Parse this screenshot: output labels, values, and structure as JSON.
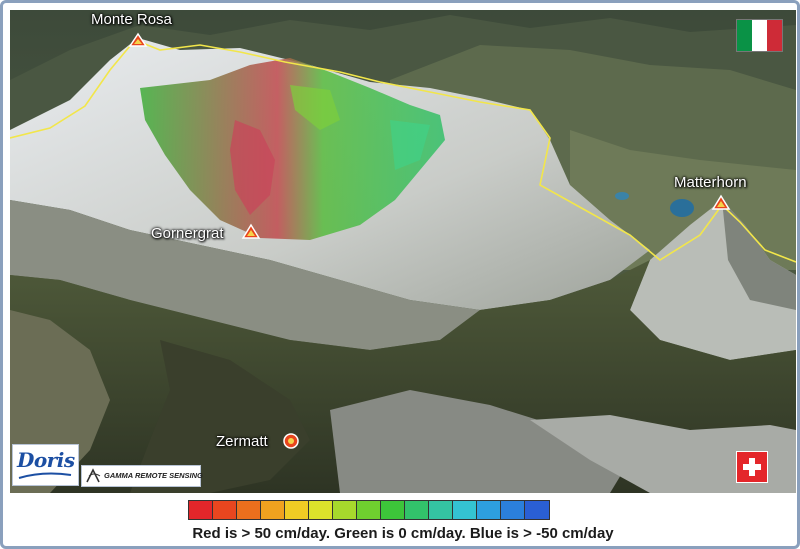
{
  "map": {
    "peaks": {
      "monte_rosa": "Monte Rosa",
      "matterhorn": "Matterhorn",
      "gornergrat": "Gornergrat",
      "zermatt": "Zermatt"
    },
    "border_color": "#f2e64a",
    "marker_color": "#e8451e"
  },
  "flags": {
    "italy": [
      "#0a9246",
      "#ffffff",
      "#ce2b37"
    ],
    "switzerland": "#e4262a"
  },
  "logos": {
    "doris": "Doris",
    "gamma": "GAMMA REMOTE SENSING"
  },
  "legend": {
    "caption": "Red is > 50 cm/day. Green is 0 cm/day. Blue is > -50 cm/day",
    "colors": [
      "#e3262a",
      "#e8461f",
      "#ec6f1d",
      "#f0a21f",
      "#f0cc24",
      "#dbe22b",
      "#a7d92c",
      "#6fcf2f",
      "#3dc53a",
      "#32c36b",
      "#34c4a2",
      "#34c3d2",
      "#2d9fe0",
      "#2b7fdb",
      "#2a5fd4"
    ]
  }
}
